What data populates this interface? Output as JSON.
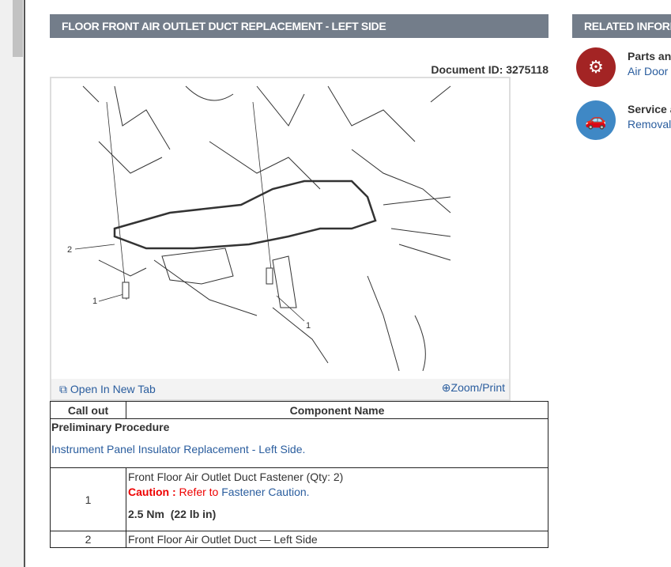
{
  "main": {
    "title": "FLOOR FRONT AIR OUTLET DUCT REPLACEMENT - LEFT SIDE",
    "document_id": "Document ID: 3275118"
  },
  "figure": {
    "open_label": "Open In New Tab",
    "zoom_label": "Zoom/Print",
    "callouts": [
      "1",
      "2",
      "1"
    ]
  },
  "table": {
    "headers": [
      "Call out",
      "Component Name"
    ],
    "preliminary_title": "Preliminary Procedure",
    "preliminary_link": "Instrument Panel Insulator Replacement - Left Side.",
    "rows": [
      {
        "callout": "1",
        "name": "Front Floor Air Outlet Duct Fastener (Qty: 2)",
        "caution_label": "Caution :",
        "caution_text": "Refer to",
        "caution_link": "Fastener Caution.",
        "torque": "2.5 Nm  (22 lb in)"
      },
      {
        "callout": "2",
        "name": "Front Floor Air Outlet Duct — Left Side"
      }
    ]
  },
  "related": {
    "title": "RELATED INFORMATION",
    "items": [
      {
        "title": "Parts and",
        "link": "Air Door ...",
        "color": "#a32424"
      },
      {
        "title": "Service and",
        "link": "Removal",
        "color": "#3f88c5"
      }
    ]
  }
}
